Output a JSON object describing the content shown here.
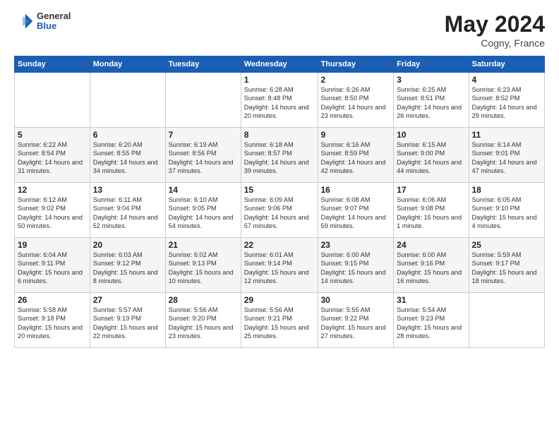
{
  "header": {
    "logo": {
      "general": "General",
      "blue": "Blue"
    },
    "title": "May 2024",
    "location": "Cogny, France"
  },
  "weekdays": [
    "Sunday",
    "Monday",
    "Tuesday",
    "Wednesday",
    "Thursday",
    "Friday",
    "Saturday"
  ],
  "weeks": [
    [
      {
        "day": "",
        "info": ""
      },
      {
        "day": "",
        "info": ""
      },
      {
        "day": "",
        "info": ""
      },
      {
        "day": "1",
        "info": "Sunrise: 6:28 AM\nSunset: 8:48 PM\nDaylight: 14 hours\nand 20 minutes."
      },
      {
        "day": "2",
        "info": "Sunrise: 6:26 AM\nSunset: 8:50 PM\nDaylight: 14 hours\nand 23 minutes."
      },
      {
        "day": "3",
        "info": "Sunrise: 6:25 AM\nSunset: 8:51 PM\nDaylight: 14 hours\nand 26 minutes."
      },
      {
        "day": "4",
        "info": "Sunrise: 6:23 AM\nSunset: 8:52 PM\nDaylight: 14 hours\nand 29 minutes."
      }
    ],
    [
      {
        "day": "5",
        "info": "Sunrise: 6:22 AM\nSunset: 8:54 PM\nDaylight: 14 hours\nand 31 minutes."
      },
      {
        "day": "6",
        "info": "Sunrise: 6:20 AM\nSunset: 8:55 PM\nDaylight: 14 hours\nand 34 minutes."
      },
      {
        "day": "7",
        "info": "Sunrise: 6:19 AM\nSunset: 8:56 PM\nDaylight: 14 hours\nand 37 minutes."
      },
      {
        "day": "8",
        "info": "Sunrise: 6:18 AM\nSunset: 8:57 PM\nDaylight: 14 hours\nand 39 minutes."
      },
      {
        "day": "9",
        "info": "Sunrise: 6:16 AM\nSunset: 8:59 PM\nDaylight: 14 hours\nand 42 minutes."
      },
      {
        "day": "10",
        "info": "Sunrise: 6:15 AM\nSunset: 9:00 PM\nDaylight: 14 hours\nand 44 minutes."
      },
      {
        "day": "11",
        "info": "Sunrise: 6:14 AM\nSunset: 9:01 PM\nDaylight: 14 hours\nand 47 minutes."
      }
    ],
    [
      {
        "day": "12",
        "info": "Sunrise: 6:12 AM\nSunset: 9:02 PM\nDaylight: 14 hours\nand 50 minutes."
      },
      {
        "day": "13",
        "info": "Sunrise: 6:11 AM\nSunset: 9:04 PM\nDaylight: 14 hours\nand 52 minutes."
      },
      {
        "day": "14",
        "info": "Sunrise: 6:10 AM\nSunset: 9:05 PM\nDaylight: 14 hours\nand 54 minutes."
      },
      {
        "day": "15",
        "info": "Sunrise: 6:09 AM\nSunset: 9:06 PM\nDaylight: 14 hours\nand 57 minutes."
      },
      {
        "day": "16",
        "info": "Sunrise: 6:08 AM\nSunset: 9:07 PM\nDaylight: 14 hours\nand 59 minutes."
      },
      {
        "day": "17",
        "info": "Sunrise: 6:06 AM\nSunset: 9:08 PM\nDaylight: 15 hours\nand 1 minute."
      },
      {
        "day": "18",
        "info": "Sunrise: 6:05 AM\nSunset: 9:10 PM\nDaylight: 15 hours\nand 4 minutes."
      }
    ],
    [
      {
        "day": "19",
        "info": "Sunrise: 6:04 AM\nSunset: 9:11 PM\nDaylight: 15 hours\nand 6 minutes."
      },
      {
        "day": "20",
        "info": "Sunrise: 6:03 AM\nSunset: 9:12 PM\nDaylight: 15 hours\nand 8 minutes."
      },
      {
        "day": "21",
        "info": "Sunrise: 6:02 AM\nSunset: 9:13 PM\nDaylight: 15 hours\nand 10 minutes."
      },
      {
        "day": "22",
        "info": "Sunrise: 6:01 AM\nSunset: 9:14 PM\nDaylight: 15 hours\nand 12 minutes."
      },
      {
        "day": "23",
        "info": "Sunrise: 6:00 AM\nSunset: 9:15 PM\nDaylight: 15 hours\nand 14 minutes."
      },
      {
        "day": "24",
        "info": "Sunrise: 6:00 AM\nSunset: 9:16 PM\nDaylight: 15 hours\nand 16 minutes."
      },
      {
        "day": "25",
        "info": "Sunrise: 5:59 AM\nSunset: 9:17 PM\nDaylight: 15 hours\nand 18 minutes."
      }
    ],
    [
      {
        "day": "26",
        "info": "Sunrise: 5:58 AM\nSunset: 9:18 PM\nDaylight: 15 hours\nand 20 minutes."
      },
      {
        "day": "27",
        "info": "Sunrise: 5:57 AM\nSunset: 9:19 PM\nDaylight: 15 hours\nand 22 minutes."
      },
      {
        "day": "28",
        "info": "Sunrise: 5:56 AM\nSunset: 9:20 PM\nDaylight: 15 hours\nand 23 minutes."
      },
      {
        "day": "29",
        "info": "Sunrise: 5:56 AM\nSunset: 9:21 PM\nDaylight: 15 hours\nand 25 minutes."
      },
      {
        "day": "30",
        "info": "Sunrise: 5:55 AM\nSunset: 9:22 PM\nDaylight: 15 hours\nand 27 minutes."
      },
      {
        "day": "31",
        "info": "Sunrise: 5:54 AM\nSunset: 9:23 PM\nDaylight: 15 hours\nand 28 minutes."
      },
      {
        "day": "",
        "info": ""
      }
    ]
  ]
}
